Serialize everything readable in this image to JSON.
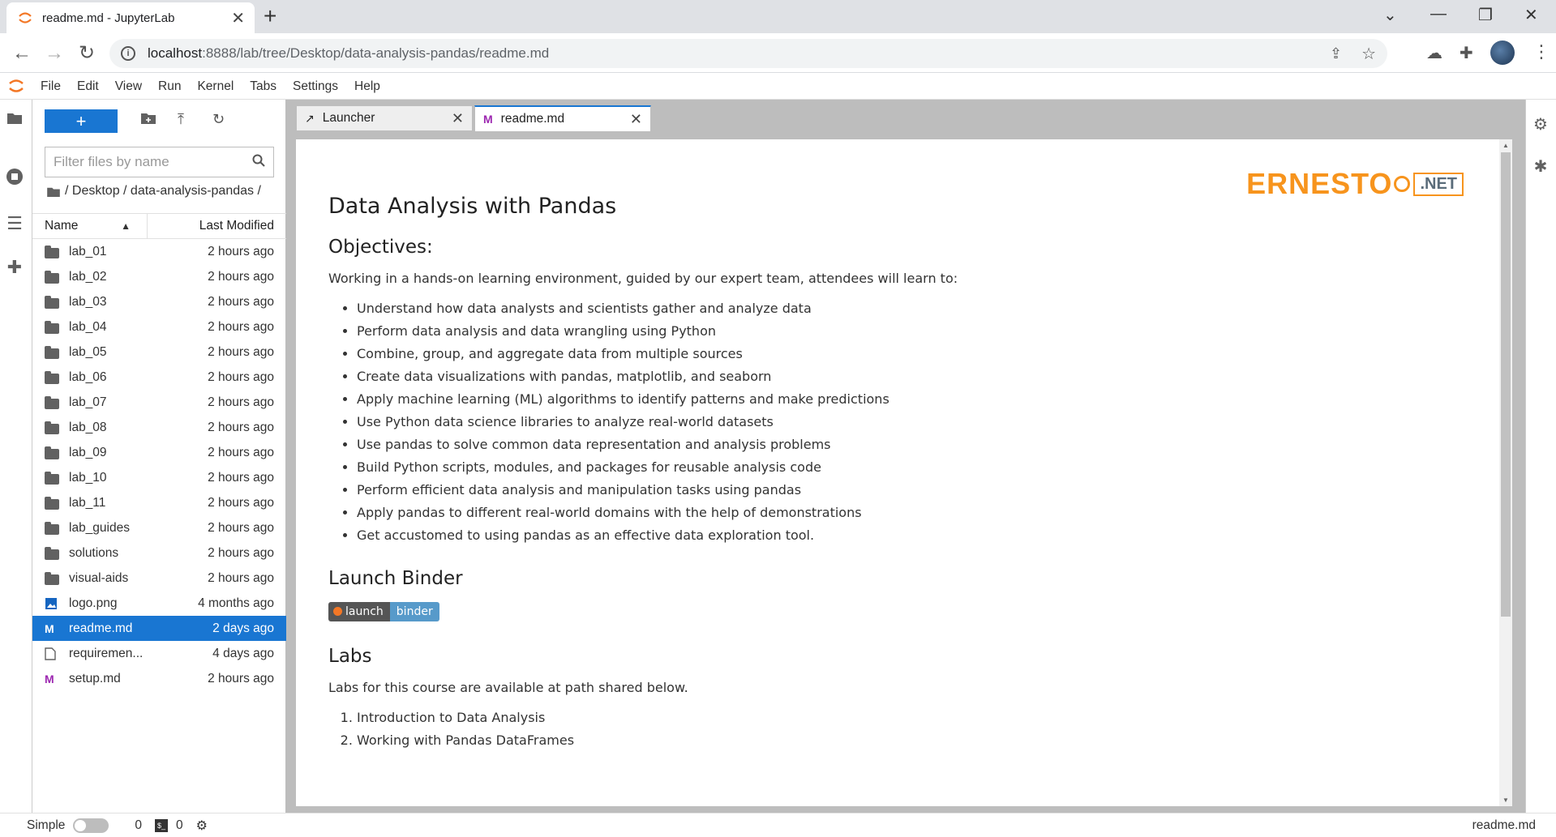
{
  "browser": {
    "tab_title": "readme.md - JupyterLab",
    "url_host": "localhost",
    "url_path": ":8888/lab/tree/Desktop/data-analysis-pandas/readme.md"
  },
  "menu": [
    "File",
    "Edit",
    "View",
    "Run",
    "Kernel",
    "Tabs",
    "Settings",
    "Help"
  ],
  "filebrowser": {
    "new_button_label": "+",
    "filter_placeholder": "Filter files by name",
    "breadcrumb": "/ Desktop / data-analysis-pandas /",
    "col_name": "Name",
    "col_modified": "Last Modified",
    "files": [
      {
        "name": "lab_01",
        "modified": "2 hours ago",
        "type": "folder"
      },
      {
        "name": "lab_02",
        "modified": "2 hours ago",
        "type": "folder"
      },
      {
        "name": "lab_03",
        "modified": "2 hours ago",
        "type": "folder"
      },
      {
        "name": "lab_04",
        "modified": "2 hours ago",
        "type": "folder"
      },
      {
        "name": "lab_05",
        "modified": "2 hours ago",
        "type": "folder"
      },
      {
        "name": "lab_06",
        "modified": "2 hours ago",
        "type": "folder"
      },
      {
        "name": "lab_07",
        "modified": "2 hours ago",
        "type": "folder"
      },
      {
        "name": "lab_08",
        "modified": "2 hours ago",
        "type": "folder"
      },
      {
        "name": "lab_09",
        "modified": "2 hours ago",
        "type": "folder"
      },
      {
        "name": "lab_10",
        "modified": "2 hours ago",
        "type": "folder"
      },
      {
        "name": "lab_11",
        "modified": "2 hours ago",
        "type": "folder"
      },
      {
        "name": "lab_guides",
        "modified": "2 hours ago",
        "type": "folder"
      },
      {
        "name": "solutions",
        "modified": "2 hours ago",
        "type": "folder"
      },
      {
        "name": "visual-aids",
        "modified": "2 hours ago",
        "type": "folder"
      },
      {
        "name": "logo.png",
        "modified": "4 months ago",
        "type": "image"
      },
      {
        "name": "readme.md",
        "modified": "2 days ago",
        "type": "markdown",
        "selected": true
      },
      {
        "name": "requiremen...",
        "modified": "4 days ago",
        "type": "file"
      },
      {
        "name": "setup.md",
        "modified": "2 hours ago",
        "type": "markdown"
      }
    ]
  },
  "doc_tabs": {
    "launcher": "Launcher",
    "readme": "readme.md"
  },
  "document": {
    "logo_text": "ERNESTO",
    "logo_net": ".NET",
    "title": "Data Analysis with Pandas",
    "objectives_heading": "Objectives:",
    "objectives_intro": "Working in a hands-on learning environment, guided by our expert team, attendees will learn to:",
    "objectives": [
      "Understand how data analysts and scientists gather and analyze data",
      "Perform data analysis and data wrangling using Python",
      "Combine, group, and aggregate data from multiple sources",
      "Create data visualizations with pandas, matplotlib, and seaborn",
      "Apply machine learning (ML) algorithms to identify patterns and make predictions",
      "Use Python data science libraries to analyze real-world datasets",
      "Use pandas to solve common data representation and analysis problems",
      "Build Python scripts, modules, and packages for reusable analysis code",
      "Perform efficient data analysis and manipulation tasks using pandas",
      "Apply pandas to different real-world domains with the help of demonstrations",
      "Get accustomed to using pandas as an effective data exploration tool."
    ],
    "binder_heading": "Launch Binder",
    "binder_left": "launch",
    "binder_right": "binder",
    "labs_heading": "Labs",
    "labs_intro": "Labs for this course are available at path shared below.",
    "labs": [
      "Introduction to Data Analysis",
      "Working with Pandas DataFrames"
    ]
  },
  "statusbar": {
    "simple_label": "Simple",
    "kernels_count": "0",
    "terminals_count": "0",
    "current_file": "readme.md"
  },
  "colors": {
    "accent": "#1976d2",
    "jupyter_orange": "#f37726",
    "logo_orange": "#f7941d"
  }
}
